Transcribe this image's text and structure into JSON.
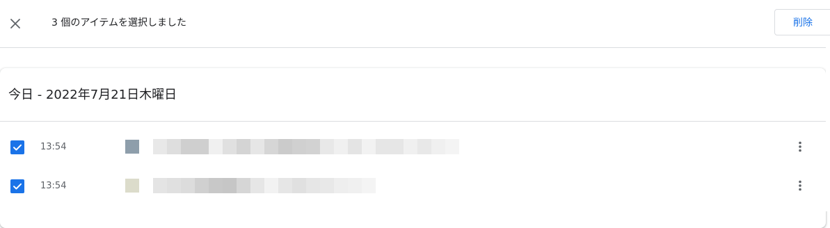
{
  "header": {
    "close_icon": "close-icon",
    "selection_text": "3 個のアイテムを選択しました",
    "delete_label": "削除",
    "accent_color": "#1a73e8"
  },
  "history": {
    "date_heading": "今日 - 2022年7月21日木曜日",
    "items": [
      {
        "checked": true,
        "time": "13:54",
        "favicon_color": "#8e9eab",
        "title_pixel_colors": [
          "#e8e8e8",
          "#dedede",
          "#cfcfcf",
          "#cfcfcf",
          "#f0f0f0",
          "#e0e0e0",
          "#d4d4d4",
          "#e6e6e6",
          "#d6d6d6",
          "#cbcbcb",
          "#d0d0d0",
          "#d2d2d2",
          "#e8e8e8",
          "#f0f0f0",
          "#e4e4e4",
          "#f2f2f2",
          "#e6e6e6",
          "#e6e6e6",
          "#f0f0f0",
          "#e8e8e8",
          "#f0f0f0",
          "#f4f4f4"
        ],
        "menu_icon": "more-vert-icon"
      },
      {
        "checked": true,
        "time": "13:54",
        "favicon_color": "#dcdccb",
        "title_pixel_colors": [
          "#e4e4e4",
          "#e0e0e0",
          "#dcdcdc",
          "#d0d0d0",
          "#c8c8c8",
          "#c6c6c6",
          "#d6d6d6",
          "#e6e6e6",
          "#f2f2f2",
          "#e6e6e6",
          "#e0e0e0",
          "#e6e6e6",
          "#e8e8e8",
          "#eeeeee",
          "#f0f0f0",
          "#f4f4f4"
        ],
        "menu_icon": "more-vert-icon"
      }
    ]
  }
}
